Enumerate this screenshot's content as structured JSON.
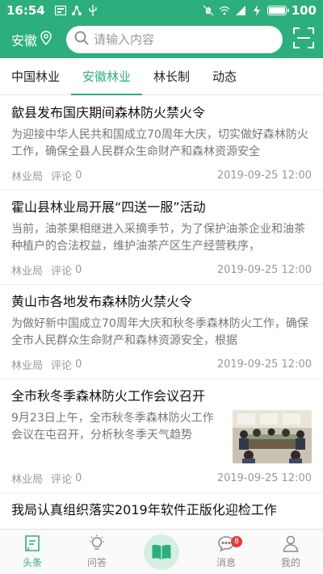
{
  "status_bar": {
    "time": "16:54",
    "battery_text": "100",
    "battery_level": 1.0
  },
  "header": {
    "location": "安徽",
    "search_placeholder": "请输入内容"
  },
  "tabs": [
    {
      "label": "中国林业",
      "active": false
    },
    {
      "label": "安徽林业",
      "active": true
    },
    {
      "label": "林长制",
      "active": false
    },
    {
      "label": "动态",
      "active": false
    }
  ],
  "articles": [
    {
      "title": "歙县发布国庆期间森林防火禁火令",
      "summary": "为迎接中华人民共和国成立70周年大庆，切实做好森林防火工作，确保全县人民群众生命财产和森林资源安全",
      "source": "林业局",
      "comments_label": "评论",
      "comments": "0",
      "time": "2019-09-25 12:00"
    },
    {
      "title": "霍山县林业局开展“四送一服”活动",
      "summary": "当前，油茶果相继进入采摘季节，为了保护油茶企业和油茶种植户的合法权益，维护油茶产区生产经营秩序，",
      "source": "林业局",
      "comments_label": "评论",
      "comments": "0",
      "time": "2019-09-25 12:00"
    },
    {
      "title": "黄山市各地发布森林防火禁火令",
      "summary": "为做好新中国成立70周年大庆和秋冬季森林防火工作，确保全市人民群众生命财产和森林资源安全，根据",
      "source": "林业局",
      "comments_label": "评论",
      "comments": "0",
      "time": "2019-09-25 12:00"
    },
    {
      "title": "全市秋冬季森林防火工作会议召开",
      "summary": "9月23日上午，全市秋冬季森林防火工作会议在屯召开，分析秋冬季天气趋势",
      "source": "林业局",
      "comments_label": "评论",
      "comments": "0",
      "time": "2019-09-25 12:00",
      "has_thumbnail": true
    },
    {
      "title": "我局认真组织落实2019年软件正版化迎检工作",
      "summary": "",
      "source": "",
      "comments_label": "",
      "comments": "",
      "time": ""
    }
  ],
  "bottom_nav": [
    {
      "label": "头条",
      "icon": "headline-icon",
      "active": true
    },
    {
      "label": "问答",
      "icon": "lightbulb-icon",
      "active": false
    },
    {
      "label": "",
      "icon": "book-icon",
      "active": false
    },
    {
      "label": "消息",
      "icon": "message-icon",
      "active": false,
      "badge": "8"
    },
    {
      "label": "我的",
      "icon": "user-icon",
      "active": false
    }
  ],
  "colors": {
    "brand": "#2dae7d",
    "badge": "#e43b3b"
  }
}
